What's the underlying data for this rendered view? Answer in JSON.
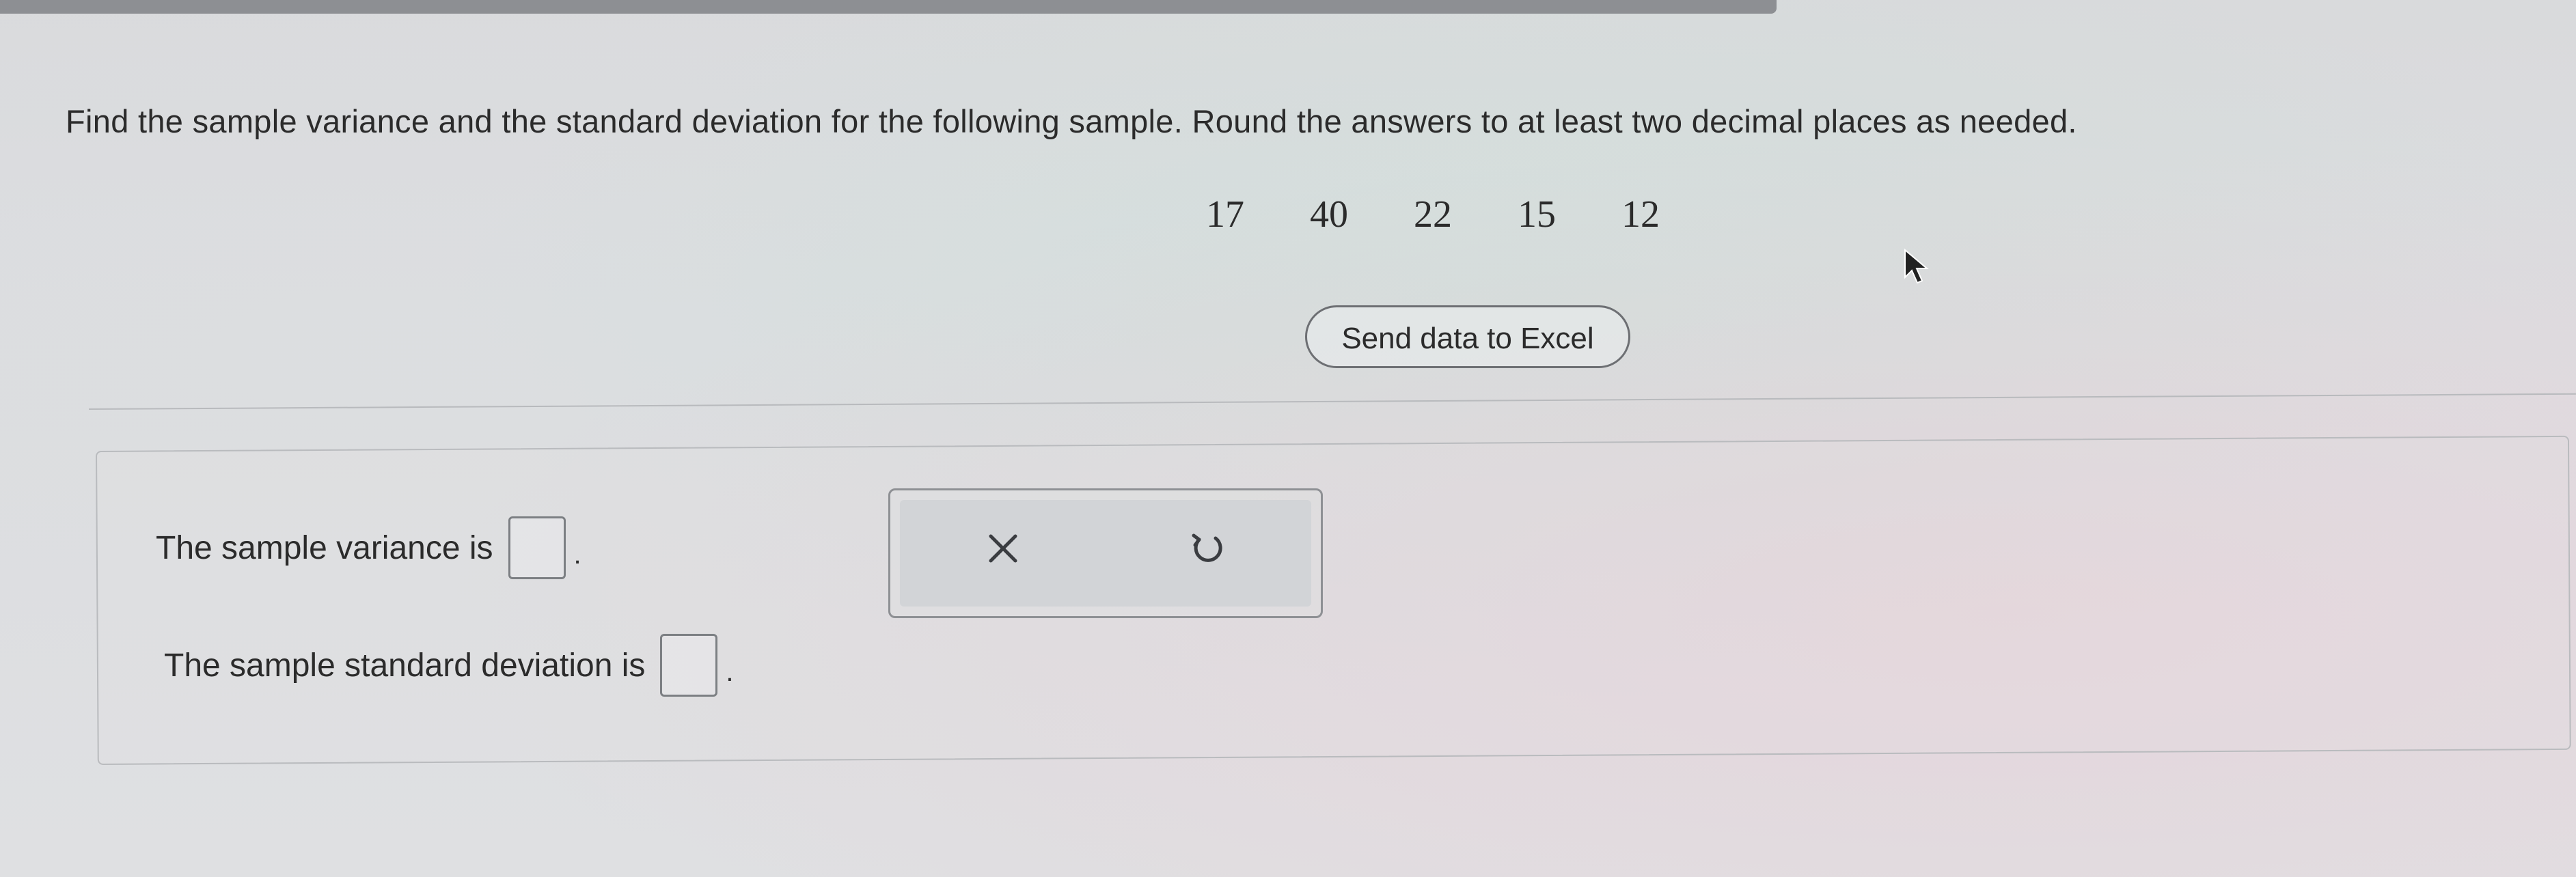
{
  "question": {
    "text": "Find the sample variance and the standard deviation for the following sample. Round the answers to at least two decimal places as needed."
  },
  "sample": {
    "values": [
      "17",
      "40",
      "22",
      "15",
      "12"
    ]
  },
  "send_button": {
    "label": "Send data to Excel"
  },
  "answers": {
    "variance_label": "The sample variance is",
    "variance_value": "",
    "stddev_label": "The sample standard deviation is",
    "stddev_value": "",
    "terminator": "."
  },
  "tools": {
    "clear_icon": "x-icon",
    "undo_icon": "undo-icon"
  }
}
